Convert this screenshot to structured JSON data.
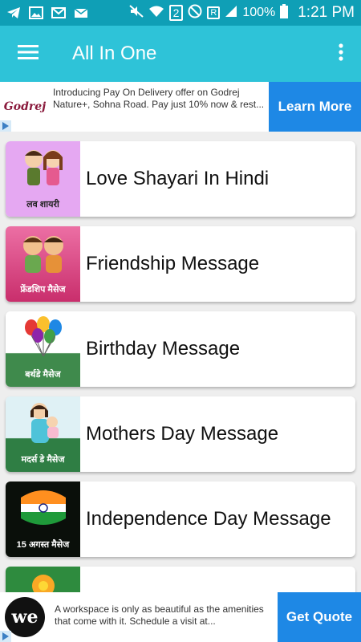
{
  "status_bar": {
    "sim": "2",
    "battery": "100%",
    "time": "1:21 PM",
    "signal_badge": "R"
  },
  "app_bar": {
    "title": "All In One",
    "menu_icon": "hamburger-menu-icon",
    "more_icon": "more-vert-icon"
  },
  "ad_top": {
    "logo_text": "Godrej",
    "text": "Introducing Pay On Delivery offer on Godrej Nature+, Sohna Road. Pay just 10% now & rest...",
    "cta": "Learn More"
  },
  "items": [
    {
      "title": "Love Shayari In Hindi",
      "caption": "लव शायरी",
      "bg": "#e5a8f2",
      "cap_color": "#222"
    },
    {
      "title": "Friendship Message",
      "caption": "फ्रेंडशिप मैसेज",
      "bg": "#d9387a",
      "cap_color": "#fff"
    },
    {
      "title": "Birthday Message",
      "caption": "बर्थडे मैसेज",
      "bg": "#3f8a4c",
      "cap_color": "#fff"
    },
    {
      "title": "Mothers Day Message",
      "caption": "मदर्स डे मैसेज",
      "bg": "#2f7e44",
      "cap_color": "#fff"
    },
    {
      "title": "Independence Day Message",
      "caption": "15 अगस्त मैसेज",
      "bg": "#0a0f0a",
      "cap_color": "#fff"
    },
    {
      "title": "",
      "caption": "",
      "bg": "#2e8b3e",
      "cap_color": "#fff"
    }
  ],
  "ad_bottom": {
    "logo_text": "we",
    "text": "A workspace is only as beautiful as the amenities that come with it. Schedule a visit at...",
    "cta": "Get Quote"
  }
}
